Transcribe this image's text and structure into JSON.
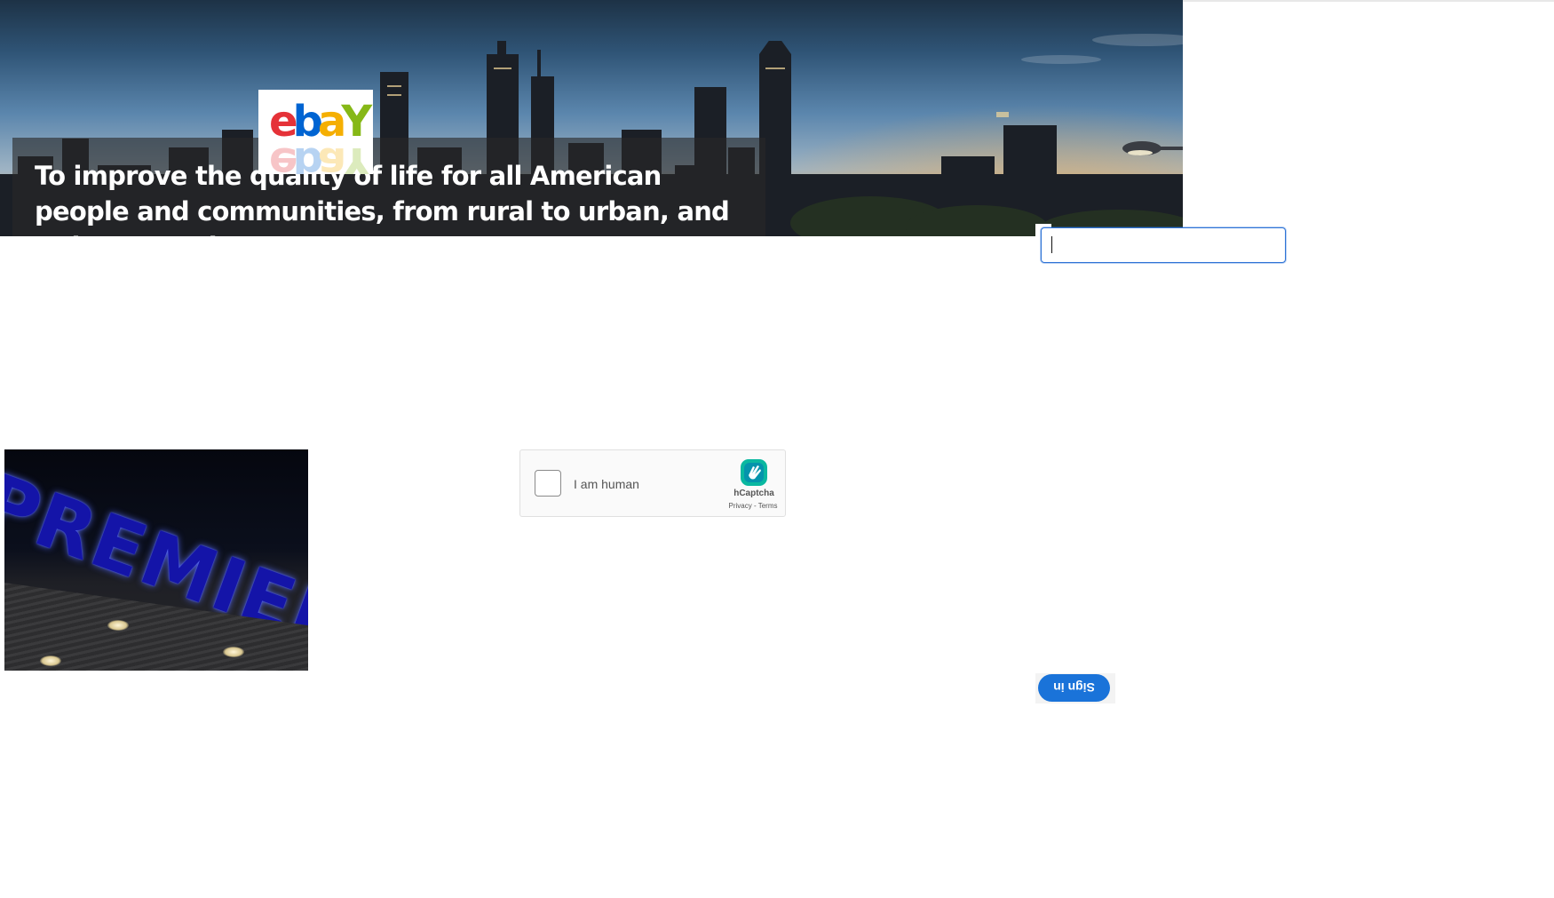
{
  "hero": {
    "background": "city skyline at sunset",
    "mission_text": "To improve the quality of life for all American people and communities, from rural to urban, and to increase the"
  },
  "logo": {
    "letters": [
      "e",
      "b",
      "a",
      "Y"
    ],
    "colors": [
      "#e53238",
      "#0064d2",
      "#f5af02",
      "#86b817"
    ]
  },
  "input": {
    "value": "",
    "placeholder": "",
    "focus_color": "#2f74d6"
  },
  "premier_image": {
    "sign_text": "PREMIER"
  },
  "captcha": {
    "label": "I am human",
    "brand": "hCaptcha",
    "privacy": "Privacy",
    "separator": " - ",
    "terms": "Terms"
  },
  "signin": {
    "label": "Sign in",
    "color": "#1a73d9"
  }
}
